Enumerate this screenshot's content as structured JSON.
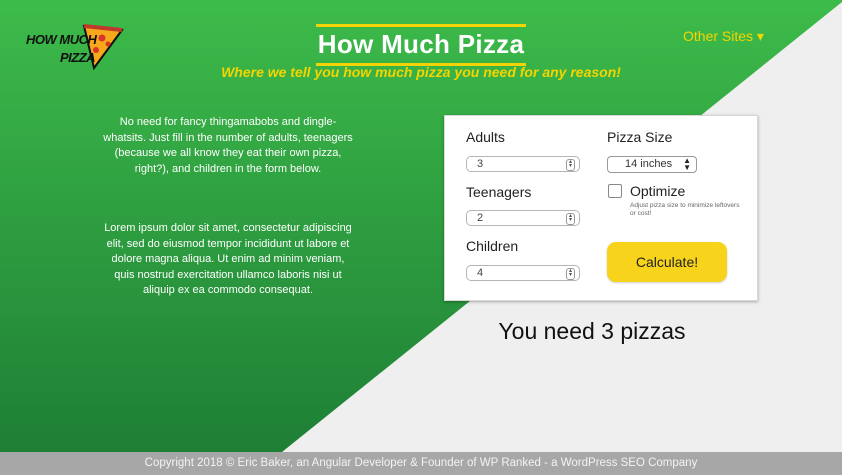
{
  "header": {
    "logo_line1": "HOW MUCH",
    "logo_line2": "PIZZA",
    "title": "How Much Pizza",
    "subtitle": "Where we tell you how much pizza you need for any reason!",
    "other_sites": "Other Sites ▾"
  },
  "content": {
    "intro": "No need for fancy thingamabobs and dingle-whatsits. Just fill in the number of adults, teenagers (because we all know they eat their own pizza, right?), and children in the form below.",
    "lorem": "Lorem ipsum dolor sit amet, consectetur adipiscing elit, sed do eiusmod tempor incididunt ut labore et dolore magna aliqua. Ut enim ad minim veniam, quis nostrud exercitation ullamco laboris nisi ut aliquip ex ea commodo consequat."
  },
  "form": {
    "adults_label": "Adults",
    "adults_value": "3",
    "teens_label": "Teenagers",
    "teens_value": "2",
    "children_label": "Children",
    "children_value": "4",
    "size_label": "Pizza Size",
    "size_value": "14 inches",
    "optimize_label": "Optimize",
    "optimize_help": "Adjust pizza size to minimize leftovers or cost!",
    "optimize_checked": false,
    "calculate_label": "Calculate!"
  },
  "result": "You need 3 pizzas",
  "footer": "Copyright 2018 © Eric Baker, an Angular Developer & Founder of WP Ranked - a WordPress SEO Company",
  "colors": {
    "green_top": "#3dbb4a",
    "green_bottom": "#1e7f35",
    "accent_yellow": "#f5d400",
    "button_yellow": "#f7d31b",
    "light_bg": "#efefef",
    "footer_bg": "#a7a7a7"
  },
  "icons": {
    "logo": "pizza-slice-icon",
    "spinner": "stepper-arrows-icon",
    "select_arrows": "updown-arrows-icon"
  }
}
